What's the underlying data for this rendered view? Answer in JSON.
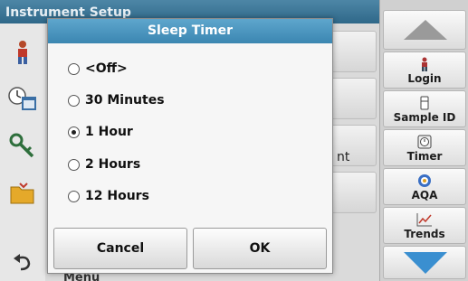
{
  "screen": {
    "title": "Instrument Setup",
    "row3_partial": "nt",
    "bottom_partial": "Menu"
  },
  "dialog": {
    "title": "Sleep Timer",
    "options": [
      {
        "label": "<Off>",
        "selected": false
      },
      {
        "label": "30 Minutes",
        "selected": false
      },
      {
        "label": "1 Hour",
        "selected": true
      },
      {
        "label": "2 Hours",
        "selected": false
      },
      {
        "label": "12 Hours",
        "selected": false
      }
    ],
    "cancel_label": "Cancel",
    "ok_label": "OK"
  },
  "sidebar": {
    "login": "Login",
    "sample_id": "Sample ID",
    "timer": "Timer",
    "aqa": "AQA",
    "trends": "Trends"
  },
  "colors": {
    "title_bar": "#3b86b1",
    "nav_arrow_down": "#3a8fd0",
    "nav_arrow_up": "#9a9a9a"
  }
}
